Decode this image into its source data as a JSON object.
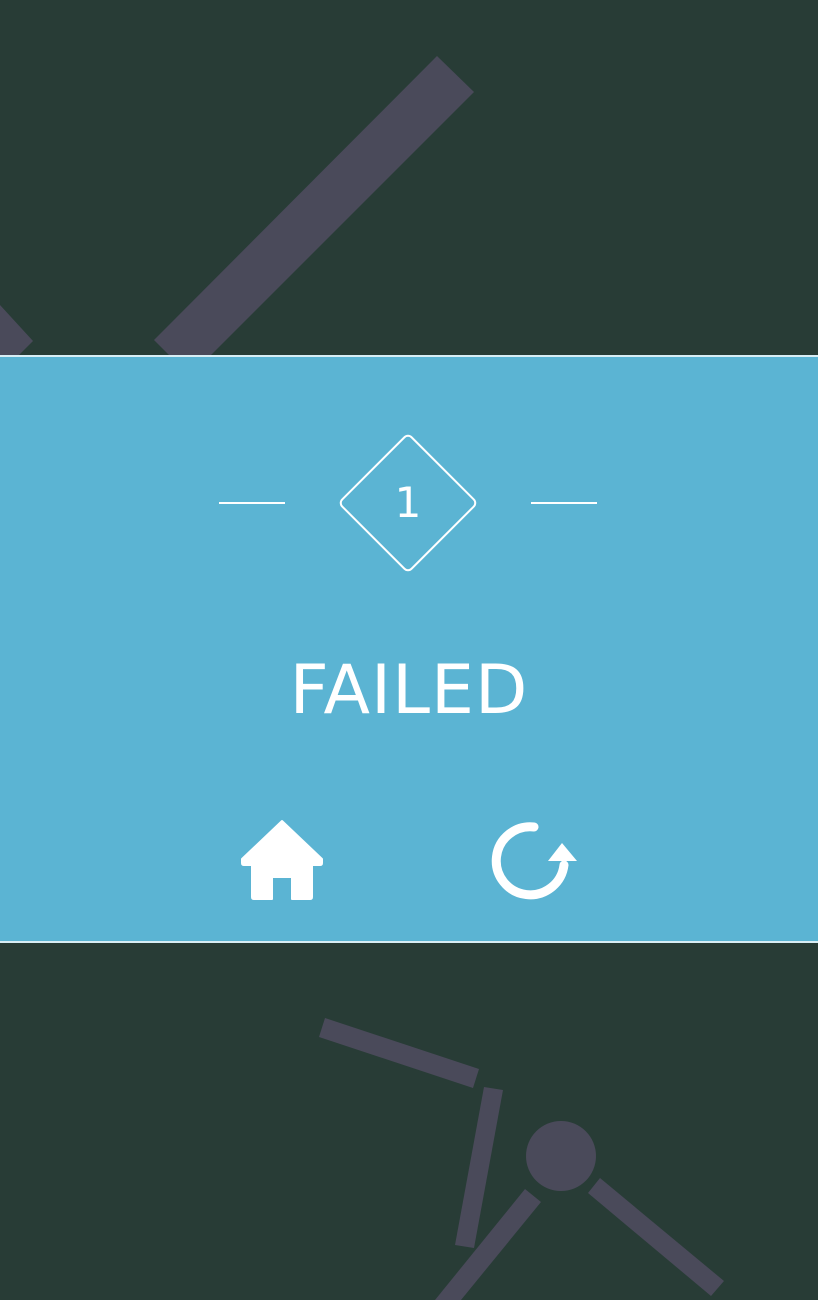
{
  "level": {
    "number": "1"
  },
  "result": {
    "status": "FAILED"
  },
  "buttons": {
    "home_icon": "home-icon",
    "restart_icon": "restart-icon"
  },
  "colors": {
    "background": "#283c36",
    "panel": "#5bb4d3",
    "panel_border": "#d8eef5",
    "figure": "#4a4a5a",
    "text": "#ffffff"
  }
}
